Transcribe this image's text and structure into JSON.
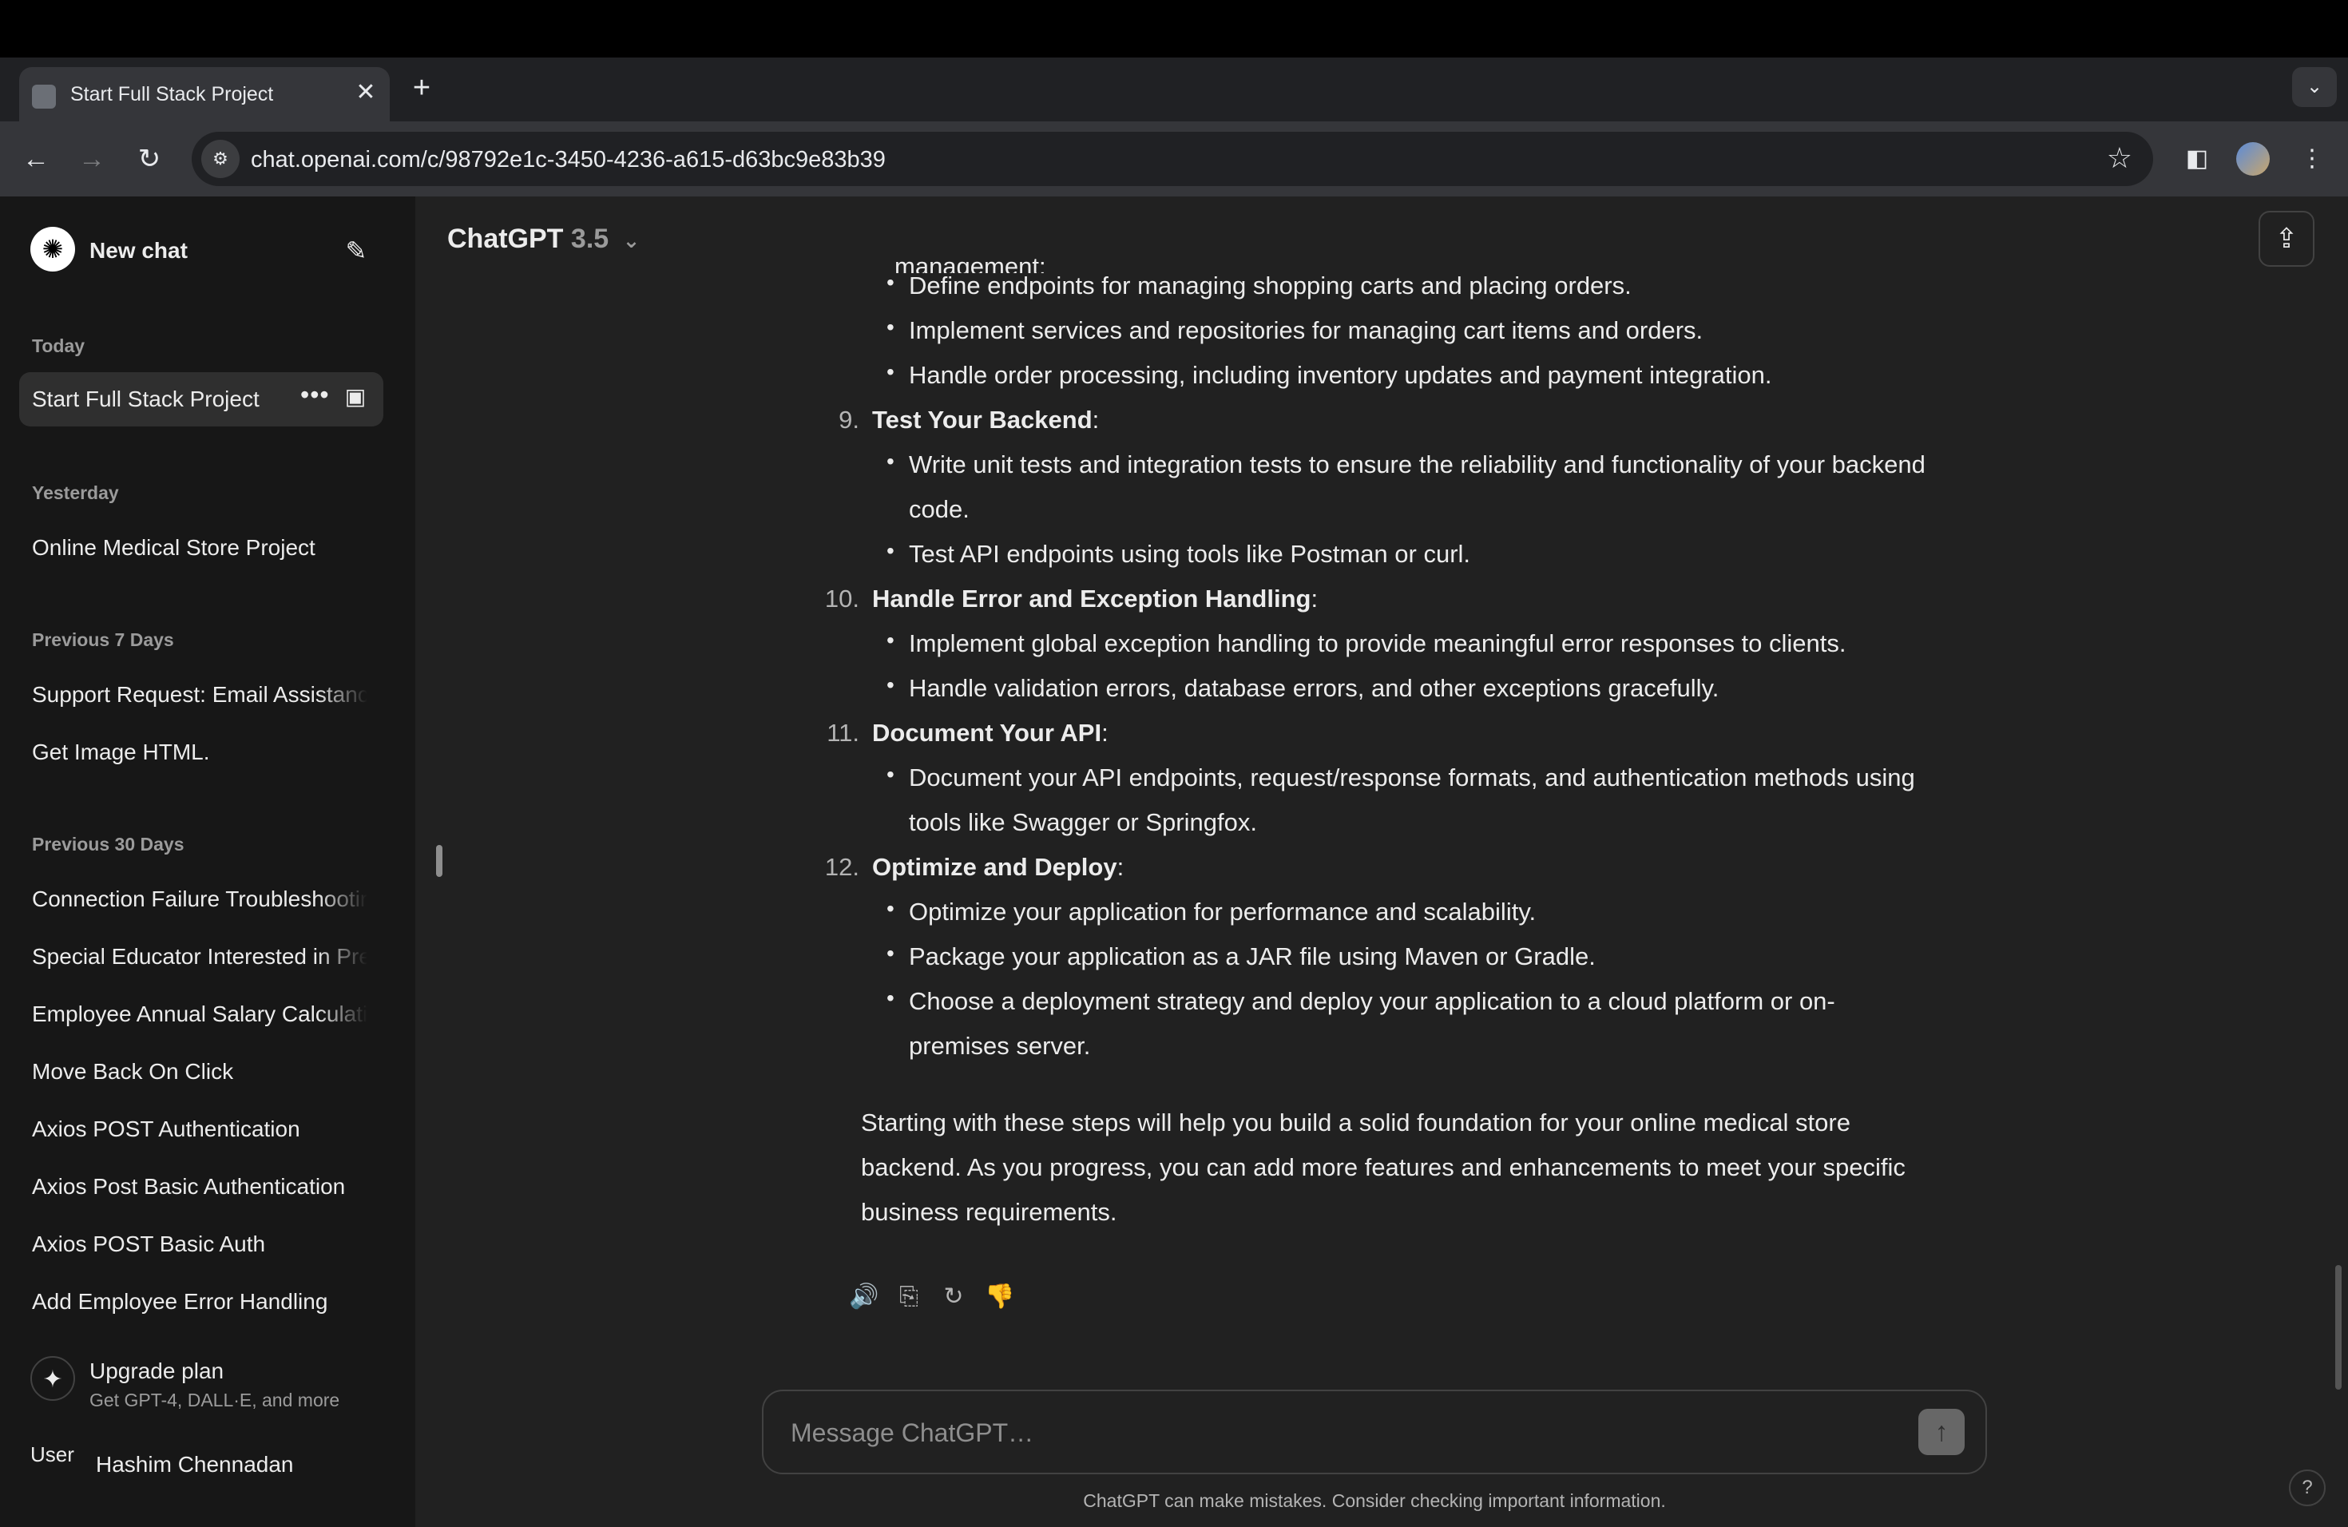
{
  "browser": {
    "tab_title": "Start Full Stack Project",
    "tab_close": "✕",
    "new_tab": "+",
    "tab_search": "⌄",
    "url": "chat.openai.com/c/98792e1c-3450-4236-a615-d63bc9e83b39",
    "back": "←",
    "forward": "→",
    "reload": "↻",
    "site_info": "⚙",
    "star": "☆",
    "sidepanel": "◧",
    "menu": "⋮"
  },
  "sidebar": {
    "logo": "✺",
    "new_chat": "New chat",
    "edit": "✎",
    "sections": [
      {
        "label": "Today"
      },
      {
        "label": "Yesterday"
      },
      {
        "label": "Previous 7 Days"
      },
      {
        "label": "Previous 30 Days"
      }
    ],
    "active_item": "Start Full Stack Project",
    "active_dots": "•••",
    "active_archive": "▣",
    "yesterday_items": [
      "Online Medical Store Project"
    ],
    "prev7_items": [
      "Support Request: Email Assistanc",
      "Get Image HTML."
    ],
    "prev30_items": [
      "Connection Failure Troubleshootir",
      "Special Educator Interested in Pre",
      "Employee Annual Salary Calculatio",
      "Move Back On Click",
      "Axios POST Authentication",
      "Axios Post Basic Authentication",
      "Axios POST Basic Auth",
      "Add Employee Error Handling"
    ],
    "upgrade": {
      "icon": "✦",
      "title": "Upgrade plan",
      "subtitle": "Get GPT-4, DALL·E, and more"
    },
    "user": {
      "avatar_alt": "User",
      "name": "Hashim Chennadan"
    }
  },
  "header": {
    "model": "ChatGPT",
    "version": "3.5",
    "chevron": "⌄",
    "share": "⇪"
  },
  "message": {
    "cutoff_line": "Implement shopping cart and order management:",
    "blocks": [
      {
        "kind": "bullet",
        "text": "Define endpoints for managing shopping carts and placing orders."
      },
      {
        "kind": "bullet",
        "text": "Implement services and repositories for managing cart items and orders."
      },
      {
        "kind": "bullet",
        "text": "Handle order processing, including inventory updates and payment integration."
      },
      {
        "kind": "heading",
        "num": "9.",
        "text": "Test Your Backend",
        "suffix": ":"
      },
      {
        "kind": "bullet",
        "text": "Write unit tests and integration tests to ensure the reliability and functionality of your backend"
      },
      {
        "kind": "cont",
        "text": "code."
      },
      {
        "kind": "bullet",
        "text": "Test API endpoints using tools like Postman or curl."
      },
      {
        "kind": "heading",
        "num": "10.",
        "text": "Handle Error and Exception Handling",
        "suffix": ":"
      },
      {
        "kind": "bullet",
        "text": "Implement global exception handling to provide meaningful error responses to clients."
      },
      {
        "kind": "bullet",
        "text": "Handle validation errors, database errors, and other exceptions gracefully."
      },
      {
        "kind": "heading",
        "num": "11.",
        "text": "Document Your API",
        "suffix": ":"
      },
      {
        "kind": "bullet",
        "text": "Document your API endpoints, request/response formats, and authentication methods using"
      },
      {
        "kind": "cont",
        "text": "tools like Swagger or Springfox."
      },
      {
        "kind": "heading",
        "num": "12.",
        "text": "Optimize and Deploy",
        "suffix": ":"
      },
      {
        "kind": "bullet",
        "text": "Optimize your application for performance and scalability."
      },
      {
        "kind": "bullet",
        "text": "Package your application as a JAR file using Maven or Gradle."
      },
      {
        "kind": "bullet",
        "text": "Choose a deployment strategy and deploy your application to a cloud platform or on-"
      },
      {
        "kind": "cont",
        "text": "premises server."
      }
    ],
    "closing": [
      "Starting with these steps will help you build a solid foundation for your online medical store",
      "backend. As you progress, you can add more features and enhancements to meet your specific",
      "business requirements."
    ],
    "actions": {
      "read_aloud": "🔊",
      "copy": "⎘",
      "regenerate": "↻",
      "dislike": "👎"
    }
  },
  "composer": {
    "placeholder": "Message ChatGPT…",
    "send": "↑"
  },
  "disclaimer": "ChatGPT can make mistakes. Consider checking important information.",
  "help": "?"
}
